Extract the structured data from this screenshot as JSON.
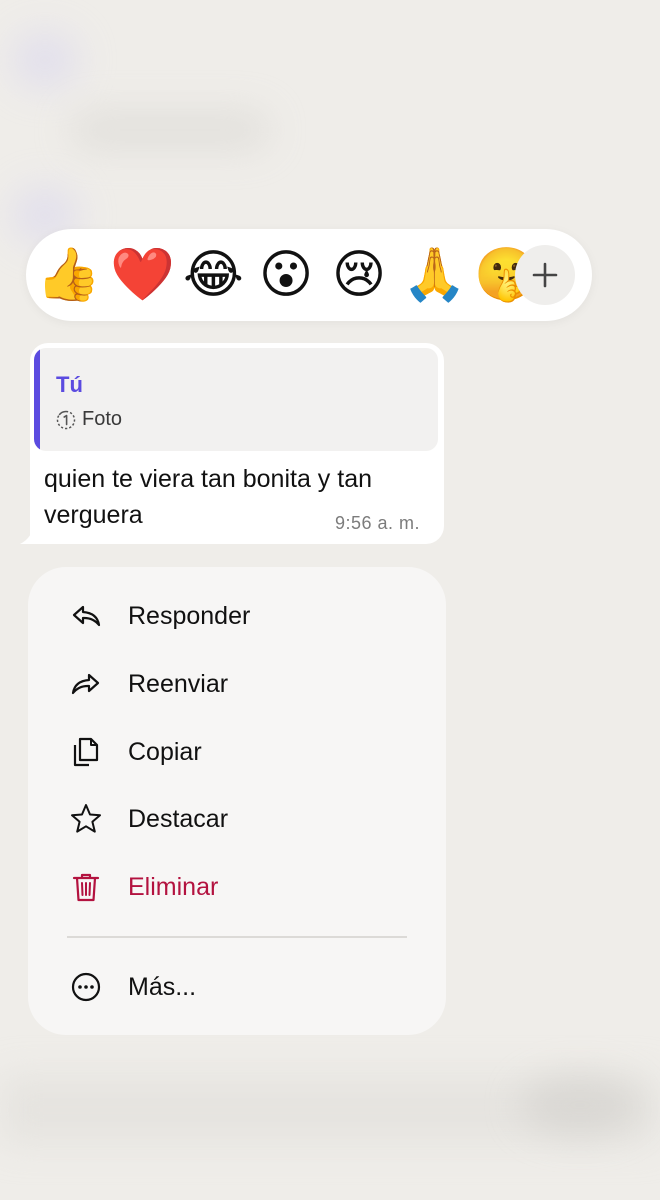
{
  "reactions": {
    "emojis": [
      {
        "name": "thumbs-up",
        "glyph": "👍"
      },
      {
        "name": "red-heart",
        "glyph": "❤️"
      },
      {
        "name": "tears-of-joy",
        "glyph": "😂"
      },
      {
        "name": "surprised",
        "glyph": "😮"
      },
      {
        "name": "crying",
        "glyph": "😢"
      },
      {
        "name": "folded-hands",
        "glyph": "🙏"
      },
      {
        "name": "shushing",
        "glyph": "🤫"
      }
    ],
    "more_icon": "plus-icon"
  },
  "message": {
    "quote": {
      "author": "Tú",
      "media_label": "Foto",
      "media_icon": "view-once-icon",
      "accent_color": "#5b4be0"
    },
    "text": "quien te viera tan bonita y tan verguera",
    "time": "9:56 a. m."
  },
  "menu": {
    "items": [
      {
        "label": "Responder",
        "icon": "reply-icon"
      },
      {
        "label": "Reenviar",
        "icon": "forward-icon"
      },
      {
        "label": "Copiar",
        "icon": "copy-icon"
      },
      {
        "label": "Destacar",
        "icon": "star-icon"
      },
      {
        "label": "Eliminar",
        "icon": "trash-icon",
        "color": "#b3123f"
      }
    ],
    "more": {
      "label": "Más...",
      "icon": "more-icon"
    }
  }
}
